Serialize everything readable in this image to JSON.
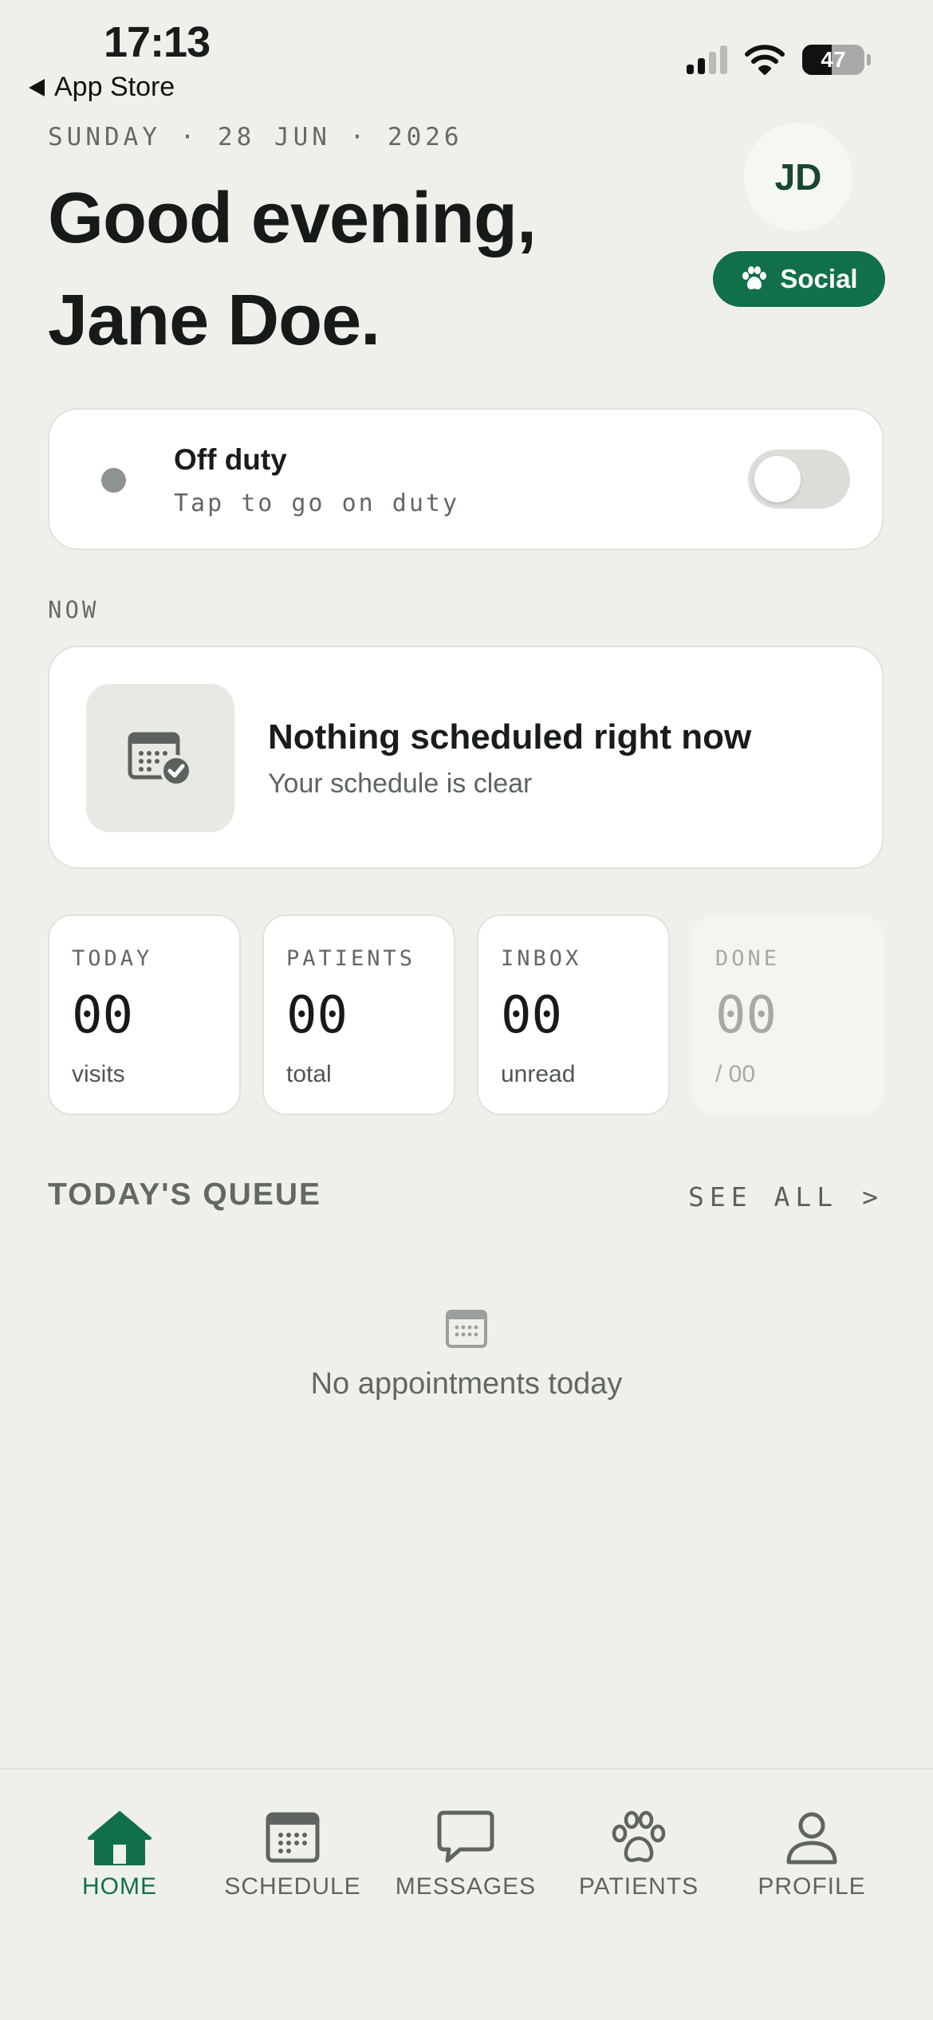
{
  "status_bar": {
    "time": "17:13",
    "back_label": "App Store",
    "battery": "47",
    "battery_level": 0.47
  },
  "header": {
    "date": "SUNDAY · 28 JUN · 2026",
    "greeting_line1": "Good evening,",
    "greeting_line2": "Jane Doe.",
    "avatar_initials": "JD",
    "badge_label": "Social"
  },
  "duty": {
    "title": "Off duty",
    "subtitle": "Tap to go on duty",
    "on": false
  },
  "now": {
    "section_label": "NOW",
    "title": "Nothing scheduled right now",
    "subtitle": "Your schedule is clear"
  },
  "stats": [
    {
      "label": "TODAY",
      "value": "00",
      "unit": "visits"
    },
    {
      "label": "PATIENTS",
      "value": "00",
      "unit": "total"
    },
    {
      "label": "INBOX",
      "value": "00",
      "unit": "unread"
    },
    {
      "label": "DONE",
      "value": "00",
      "unit": "/ 00"
    }
  ],
  "queue": {
    "title": "TODAY'S QUEUE",
    "see_all": "SEE ALL",
    "see_all_chevron": ">",
    "empty_text": "No appointments today"
  },
  "tabs": [
    {
      "label": "HOME",
      "icon": "home-icon",
      "active": true
    },
    {
      "label": "SCHEDULE",
      "icon": "calendar-icon",
      "active": false
    },
    {
      "label": "MESSAGES",
      "icon": "chat-bubble-icon",
      "active": false
    },
    {
      "label": "PATIENTS",
      "icon": "paw-icon",
      "active": false
    },
    {
      "label": "PROFILE",
      "icon": "person-icon",
      "active": false
    }
  ],
  "colors": {
    "background": "#f0f0eb",
    "accent": "#11704b",
    "card": "#ffffff",
    "muted_text": "#616864"
  }
}
